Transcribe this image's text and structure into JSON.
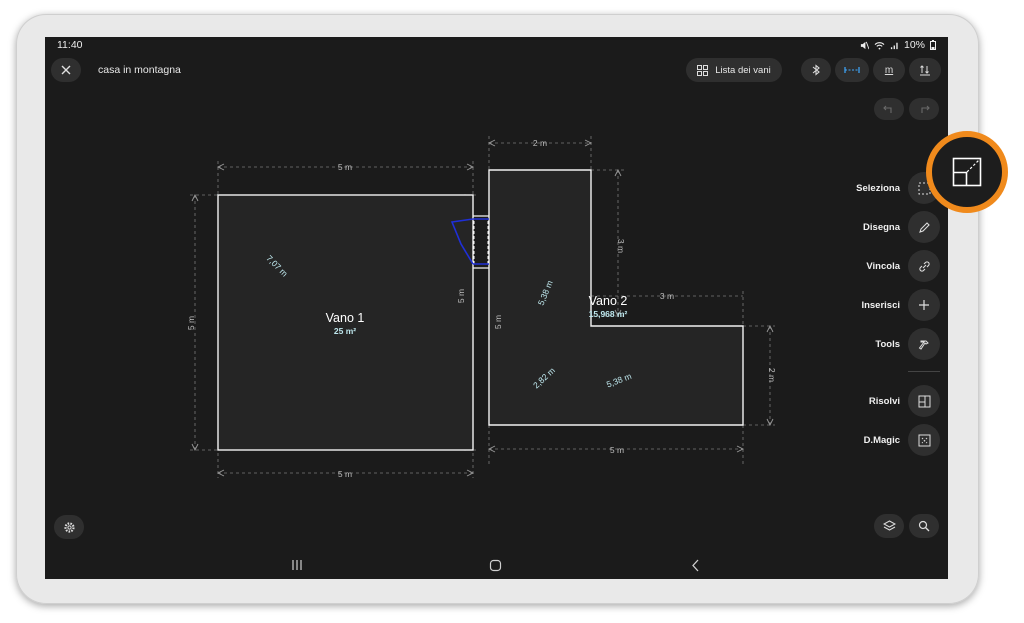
{
  "status": {
    "time": "11:40",
    "battery": "10%"
  },
  "header": {
    "title": "casa in montagna",
    "rooms_button": "Lista dei vani",
    "unit_label": "m"
  },
  "rooms": [
    {
      "name": "Vano 1",
      "area": "25 m²"
    },
    {
      "name": "Vano 2",
      "area": "15,968 m²"
    }
  ],
  "dimensions": {
    "v1_top": "5 m",
    "v1_bottom": "5 m",
    "v1_left": "5 m",
    "v1_right": "5 m",
    "v1_diag": "7,07 m",
    "v2_top": "2 m",
    "v2_stem_right": "3 m",
    "v2_arm_top": "3 m",
    "v2_right": "2 m",
    "v2_left": "5 m",
    "v2_bottom": "5 m",
    "v2_diag1": "5,38 m",
    "v2_diag2": "2,82 m",
    "v2_diag3": "5,38 m"
  },
  "tools": [
    {
      "label": "Seleziona",
      "icon": "select-icon"
    },
    {
      "label": "Disegna",
      "icon": "pencil-icon"
    },
    {
      "label": "Vincola",
      "icon": "link-icon"
    },
    {
      "label": "Inserisci",
      "icon": "plus-icon"
    },
    {
      "label": "Tools",
      "icon": "hammer-icon"
    },
    {
      "label": "Risolvi",
      "icon": "solve-icon"
    },
    {
      "label": "D.Magic",
      "icon": "magic-icon"
    }
  ]
}
